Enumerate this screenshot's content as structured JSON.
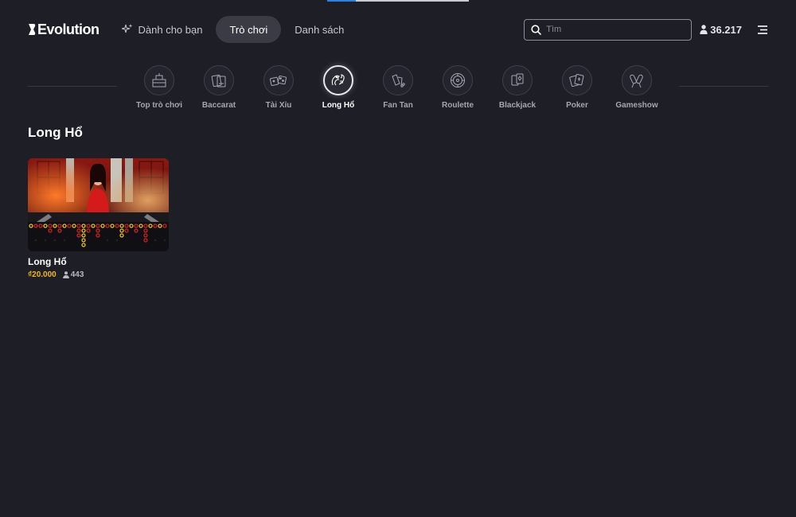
{
  "header": {
    "logo_text": "Evolution",
    "nav": [
      {
        "label": "Dành cho bạn",
        "icon": "sparkle-icon"
      },
      {
        "label": "Trò chơi",
        "active": true
      },
      {
        "label": "Danh sách"
      }
    ],
    "search": {
      "placeholder": "Tìm",
      "value": ""
    },
    "player_count": "36.217"
  },
  "categories": [
    {
      "label": "Top trò chơi",
      "icon": "top-games-icon"
    },
    {
      "label": "Baccarat",
      "icon": "baccarat-icon"
    },
    {
      "label": "Tài Xỉu",
      "icon": "dice-icon"
    },
    {
      "label": "Long Hổ",
      "icon": "dragon-tiger-icon",
      "active": true
    },
    {
      "label": "Fan Tan",
      "icon": "fan-tan-icon"
    },
    {
      "label": "Roulette",
      "icon": "roulette-icon"
    },
    {
      "label": "Blackjack",
      "icon": "blackjack-icon"
    },
    {
      "label": "Poker",
      "icon": "poker-icon"
    },
    {
      "label": "Gameshow",
      "icon": "gameshow-icon"
    }
  ],
  "section": {
    "title": "Long Hổ",
    "games": [
      {
        "name": "Long Hổ",
        "min_bet": "₫20.000",
        "players": "443"
      }
    ]
  },
  "colors": {
    "background": "#1d1e26",
    "accent_gold": "#f4b81c",
    "active_pill": "#3a3b45",
    "progress_blue": "#2f7fe0"
  },
  "page_progress": 0.2
}
